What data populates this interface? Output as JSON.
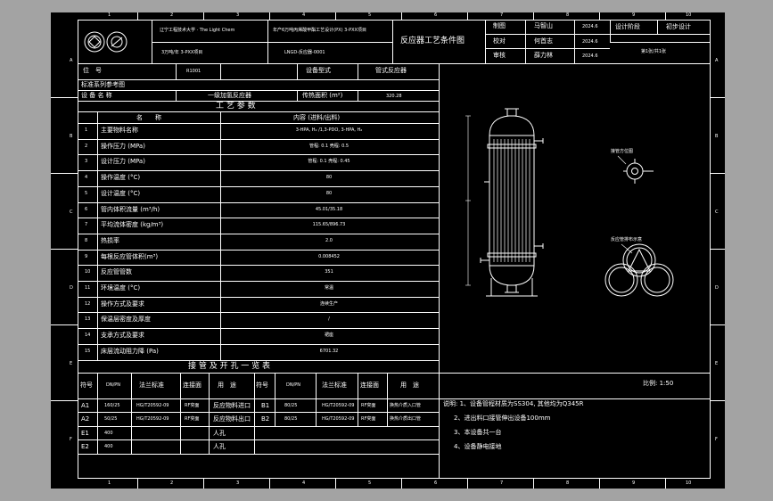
{
  "title_block": {
    "school": "辽宁工程技术大学 · The Light Chem",
    "project": "年产6万吨丙烯酸甲酯工艺设计(PX) 3-PXX项目",
    "unit_line": "3万吨/年 3-PXX项目",
    "drawing_no": "LNGD-反应器-0001",
    "drawing_title": "反应器工艺条件图",
    "rows": [
      {
        "role": "制图",
        "name": "马智山",
        "date": "2024.6"
      },
      {
        "role": "校对",
        "name": "何首志",
        "date": "2024.6"
      },
      {
        "role": "审核",
        "name": "薛力林",
        "date": "2024.6"
      }
    ],
    "stage_label": "设计阶段",
    "stage_value": "初步设计",
    "sheet_info": "第1张/共1张"
  },
  "border": {
    "top_marks": [
      "1",
      "2",
      "3",
      "4",
      "5",
      "6",
      "7",
      "8",
      "9",
      "10"
    ],
    "side_marks": [
      "A",
      "B",
      "C",
      "D",
      "E",
      "F"
    ]
  },
  "info": {
    "position_label": "位　号",
    "position_value": "R1001",
    "equip_form_label": "设备型式",
    "equip_form_value": "管式反应器",
    "standard_label": "标准系列参考图",
    "name_label": "设 备 名 称",
    "name_value": "一级加氢反应器",
    "area_label": "传热面积 (m²)",
    "area_value": "320.28"
  },
  "params": {
    "section_title": "工 艺 参 数",
    "col_name": "名　　称",
    "col_content": "内容 (进料/出料)",
    "rows": [
      {
        "no": "1",
        "name": "主要物料名称",
        "value": "3-HPA, H₂ /1,3-PDO, 3-HPA, H₂"
      },
      {
        "no": "2",
        "name": "操作压力 (MPa)",
        "value": "管程: 0.1  壳程: 0.5"
      },
      {
        "no": "3",
        "name": "设计压力 (MPa)",
        "value": "管程: 0.1  壳程: 0.45"
      },
      {
        "no": "4",
        "name": "操作温度 (°C)",
        "value": "80"
      },
      {
        "no": "5",
        "name": "设计温度 (°C)",
        "value": "80"
      },
      {
        "no": "6",
        "name": "管内体积流量 (m³/h)",
        "value": "45.01/35.18"
      },
      {
        "no": "7",
        "name": "平均流体密度 (kg/m³)",
        "value": "115.65/896.73"
      },
      {
        "no": "8",
        "name": "热损率",
        "value": "2.0"
      },
      {
        "no": "9",
        "name": "每根反应管体积(m³)",
        "value": "0.008452"
      },
      {
        "no": "10",
        "name": "反应管管数",
        "value": "351"
      },
      {
        "no": "11",
        "name": "环境温度 (°C)",
        "value": "常温"
      },
      {
        "no": "12",
        "name": "操作方式及要求",
        "value": "连续生产"
      },
      {
        "no": "13",
        "name": "保温层密度及厚度",
        "value": "/"
      },
      {
        "no": "14",
        "name": "支承方式及要求",
        "value": "裙座"
      },
      {
        "no": "15",
        "name": "床层流动阻力降 (Pa)",
        "value": "6701.32"
      }
    ]
  },
  "nozzles": {
    "section_title": "接 管 及 开 孔 一 览 表",
    "headers": [
      "符号",
      "DN/PN",
      "法兰标准",
      "连接面",
      "用　途",
      "符号",
      "DN/PN",
      "法兰标准",
      "连接面",
      "用　途"
    ],
    "rows": [
      {
        "left": [
          "A1",
          "160/25",
          "HG/T20592-09",
          "RF突面",
          "反应物料进口"
        ],
        "right": [
          "B1",
          "80/25",
          "HG/T20592-09",
          "RF突面",
          "换热介质入口管"
        ]
      },
      {
        "left": [
          "A2",
          "50/25",
          "HG/T20592-09",
          "RF突面",
          "反应物料出口"
        ],
        "right": [
          "B2",
          "80/25",
          "HG/T20592-09",
          "RF突面",
          "换热介质出口管"
        ]
      },
      {
        "left": [
          "E1",
          "400",
          "",
          "",
          "人孔"
        ],
        "right": []
      },
      {
        "left": [
          "E2",
          "400",
          "",
          "",
          "人孔"
        ],
        "right": []
      }
    ]
  },
  "notes": {
    "scale": "比例: 1:50",
    "lines": [
      "说明: 1、设备管程材质为SS304, 其他均为Q345R",
      "2、进出料口接管伸出设备100mm",
      "3、本设备共一台",
      "4、设备静电接地"
    ]
  },
  "drawing": {
    "nozzle_view_label": "接管方位图",
    "tube_layout_label": "反应管排布示意"
  }
}
